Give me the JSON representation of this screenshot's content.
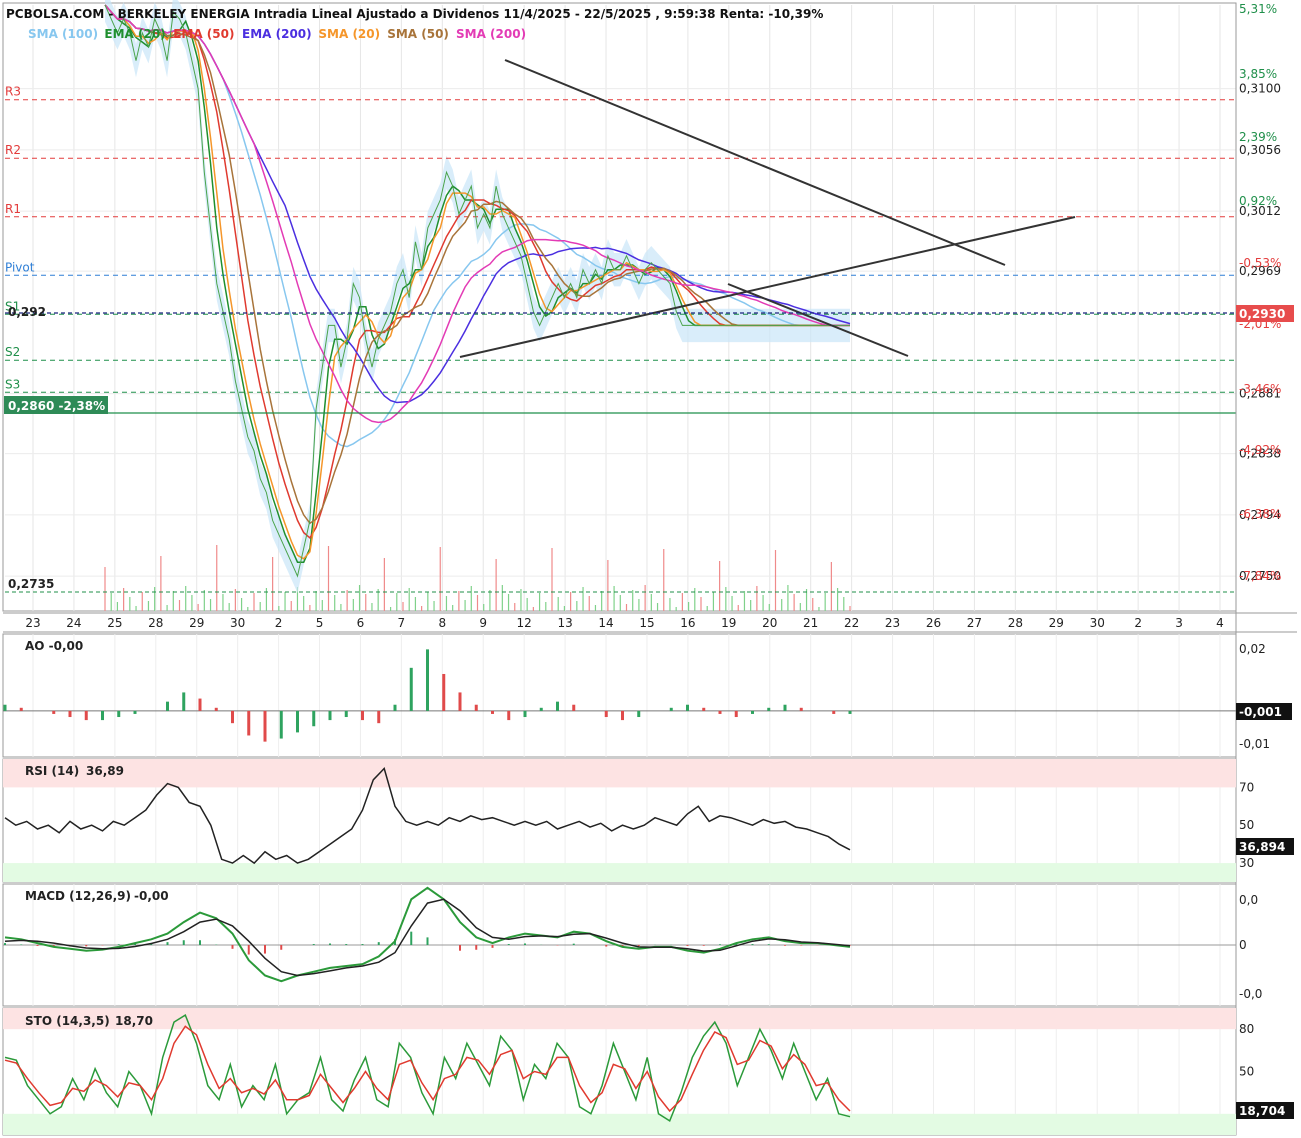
{
  "header": {
    "title": "PCBOLSA.COM - BERKELEY ENERGIA Intradia Lineal Ajustado a Dividenos 11/4/2025 - 22/5/2025 , 9:59:38 Renta: -10,39%"
  },
  "legend": [
    {
      "label": "SMA (100)",
      "color": "#87c7ef"
    },
    {
      "label": "EMA (20)",
      "color": "#1f8f2f"
    },
    {
      "label": "EMA (50)",
      "color": "#e03a2f"
    },
    {
      "label": "EMA (200)",
      "color": "#4b2fe0"
    },
    {
      "label": "SMA (20)",
      "color": "#f5962a"
    },
    {
      "label": "SMA (50)",
      "color": "#a8743a"
    },
    {
      "label": "SMA (200)",
      "color": "#e33bb5"
    }
  ],
  "pivots": [
    {
      "label": "R3",
      "value": 0.3092,
      "color": "#e33b3b"
    },
    {
      "label": "R2",
      "value": 0.305,
      "color": "#e33b3b"
    },
    {
      "label": "R1",
      "value": 0.3008,
      "color": "#e33b3b"
    },
    {
      "label": "Pivot",
      "value": 0.2966,
      "color": "#2f7fd6"
    },
    {
      "label": "S1",
      "value": 0.2938,
      "color": "#1f8f4a"
    },
    {
      "label": "S2",
      "value": 0.2905,
      "color": "#1f8f4a"
    },
    {
      "label": "S3",
      "value": 0.2882,
      "color": "#1f8f4a"
    }
  ],
  "markers": {
    "last_price": "0,2930",
    "level_292": "0,292",
    "support_tag": "0,2860 -2,38%",
    "low_label": "0,2735"
  },
  "chart_data": [
    {
      "type": "line",
      "title": "PCBOLSA.COM - BERKELEY ENERGIA Intradia Lineal Ajustado a Dividenos 11/4/2025 - 22/5/2025 , 9:59:38 Renta: -10,39%",
      "x_tick_labels": [
        "23",
        "24",
        "25",
        "28",
        "29",
        "30",
        "2",
        "5",
        "6",
        "7",
        "8",
        "9",
        "12",
        "13",
        "14",
        "15",
        "16",
        "19",
        "20",
        "21",
        "22",
        "23",
        "26",
        "27",
        "28",
        "29",
        "30",
        "2",
        "3",
        "4"
      ],
      "y_tick_labels": [
        "0,3100",
        "0,3056",
        "0,3012",
        "0,2969",
        "0,2930",
        "0,2881",
        "0,2838",
        "0,2794",
        "0,2750"
      ],
      "y_pct_labels": [
        "5,31%",
        "3,85%",
        "2,39%",
        "0,92%",
        "-0,53%",
        "-2,01%",
        "-3,46%",
        "-4,92%",
        "-6,38%",
        "-7,84%"
      ],
      "ylim": [
        0.2725,
        0.316
      ],
      "last": 0.293,
      "series": [
        {
          "name": "Precio",
          "x": [
            0,
            1,
            2,
            3,
            4,
            5,
            6,
            7,
            8,
            9,
            10,
            11,
            12,
            13,
            14,
            15,
            16,
            17,
            18,
            19,
            20,
            21,
            22,
            23,
            24,
            25,
            26,
            27,
            28,
            29,
            30,
            31,
            32,
            33,
            34,
            35,
            36,
            37,
            38,
            39,
            40,
            41,
            42,
            43,
            44,
            45,
            46,
            47,
            48,
            49,
            50,
            51,
            52,
            53,
            54,
            55,
            56,
            57,
            58,
            59,
            60,
            61,
            62,
            63,
            64,
            65,
            66,
            67,
            68,
            69,
            70,
            71,
            72,
            73,
            74,
            75,
            76,
            77,
            78,
            79,
            80,
            81,
            82,
            83,
            84,
            85,
            86,
            87,
            88,
            89,
            90,
            91,
            92,
            93,
            94,
            95,
            96,
            97,
            98,
            99,
            100,
            101,
            102,
            103,
            104,
            105,
            106,
            107,
            108,
            109,
            110,
            111,
            112,
            113,
            114,
            115,
            116,
            117,
            118,
            119,
            120
          ],
          "values": [
            0.316,
            0.315,
            0.314,
            0.315,
            0.314,
            0.312,
            0.314,
            0.313,
            0.315,
            0.314,
            0.312,
            0.3155,
            0.315,
            0.314,
            0.312,
            0.31,
            0.304,
            0.3,
            0.296,
            0.294,
            0.292,
            0.289,
            0.287,
            0.285,
            0.284,
            0.282,
            0.281,
            0.279,
            0.278,
            0.277,
            0.276,
            0.275,
            0.277,
            0.279,
            0.287,
            0.29,
            0.293,
            0.293,
            0.29,
            0.292,
            0.296,
            0.295,
            0.292,
            0.29,
            0.292,
            0.293,
            0.294,
            0.296,
            0.297,
            0.295,
            0.299,
            0.297,
            0.3,
            0.301,
            0.302,
            0.304,
            0.303,
            0.301,
            0.302,
            0.303,
            0.3,
            0.301,
            0.3,
            0.303,
            0.301,
            0.3,
            0.299,
            0.298,
            0.296,
            0.294,
            0.293,
            0.294,
            0.295,
            0.296,
            0.295,
            0.296,
            0.295,
            0.297,
            0.296,
            0.297,
            0.296,
            0.298,
            0.297,
            0.297,
            0.298,
            0.297,
            0.296,
            0.297,
            0.2975,
            0.297,
            0.2965,
            0.296,
            0.294,
            0.293,
            0.293,
            0.293,
            0.293,
            0.293,
            0.293,
            0.293,
            0.293,
            0.293,
            0.293,
            0.293,
            0.293,
            0.293,
            0.293,
            0.293,
            0.293,
            0.293,
            0.293,
            0.293,
            0.293,
            0.293,
            0.293,
            0.293,
            0.293,
            0.293,
            0.293,
            0.293,
            0.293
          ],
          "color": "#1f8f2f"
        }
      ]
    },
    {
      "type": "line",
      "title": "AO -0,00",
      "y_tick_labels": [
        "0,02",
        "-0,01"
      ],
      "last": "-0,001",
      "ylim": [
        -0.015,
        0.025
      ],
      "values": [
        0.002,
        0.001,
        0.0,
        -0.001,
        -0.002,
        -0.003,
        -0.003,
        -0.002,
        -0.001,
        0.0,
        0.003,
        0.006,
        0.004,
        0.001,
        -0.004,
        -0.008,
        -0.01,
        -0.009,
        -0.007,
        -0.005,
        -0.003,
        -0.002,
        -0.003,
        -0.004,
        0.002,
        0.014,
        0.02,
        0.012,
        0.006,
        0.002,
        -0.001,
        -0.003,
        -0.002,
        0.001,
        0.003,
        0.002,
        0.0,
        -0.002,
        -0.003,
        -0.002,
        0.0,
        0.001,
        0.002,
        0.001,
        -0.001,
        -0.002,
        -0.001,
        0.001,
        0.002,
        0.001,
        0.0,
        -0.001,
        -0.001
      ]
    },
    {
      "type": "line",
      "title": "RSI (14)",
      "value_label": "36,89",
      "y_tick_labels": [
        "70",
        "50",
        "30"
      ],
      "last": "36,894",
      "ylim": [
        20,
        85
      ],
      "values": [
        54,
        50,
        52,
        48,
        50,
        46,
        52,
        48,
        50,
        47,
        52,
        50,
        54,
        58,
        66,
        72,
        70,
        62,
        60,
        50,
        32,
        30,
        34,
        30,
        36,
        32,
        34,
        30,
        32,
        36,
        40,
        44,
        48,
        58,
        74,
        80,
        60,
        52,
        50,
        52,
        50,
        54,
        52,
        55,
        53,
        54,
        52,
        50,
        52,
        50,
        52,
        48,
        50,
        52,
        49,
        51,
        47,
        50,
        48,
        50,
        54,
        52,
        50,
        56,
        60,
        52,
        55,
        54,
        52,
        50,
        53,
        51,
        52,
        49,
        48,
        46,
        44,
        40,
        37
      ]
    },
    {
      "type": "line",
      "title": "MACD (12,26,9)",
      "value_label": "-0,00",
      "y_tick_labels": [
        "0,0",
        "0",
        "-0,0"
      ],
      "ylim": [
        -1.6,
        1.6
      ],
      "series": [
        {
          "name": "MACD",
          "values": [
            0.2,
            0.15,
            0.05,
            -0.05,
            -0.1,
            -0.15,
            -0.12,
            -0.05,
            0.05,
            0.15,
            0.3,
            0.6,
            0.85,
            0.7,
            0.3,
            -0.4,
            -0.8,
            -0.95,
            -0.8,
            -0.7,
            -0.6,
            -0.55,
            -0.5,
            -0.3,
            0.1,
            1.2,
            1.5,
            1.2,
            0.6,
            0.2,
            0.05,
            0.2,
            0.3,
            0.25,
            0.2,
            0.35,
            0.3,
            0.1,
            -0.05,
            -0.1,
            -0.05,
            -0.05,
            -0.15,
            -0.2,
            -0.1,
            0.05,
            0.15,
            0.2,
            0.1,
            0.05,
            0.05,
            0.0,
            -0.05
          ]
        },
        {
          "name": "Signal",
          "values": [
            0.1,
            0.12,
            0.1,
            0.05,
            -0.02,
            -0.08,
            -0.1,
            -0.09,
            -0.04,
            0.04,
            0.15,
            0.35,
            0.6,
            0.68,
            0.5,
            0.1,
            -0.35,
            -0.7,
            -0.8,
            -0.75,
            -0.68,
            -0.6,
            -0.55,
            -0.45,
            -0.2,
            0.5,
            1.1,
            1.2,
            0.9,
            0.45,
            0.2,
            0.15,
            0.22,
            0.24,
            0.22,
            0.28,
            0.3,
            0.18,
            0.05,
            -0.05,
            -0.06,
            -0.06,
            -0.1,
            -0.16,
            -0.14,
            -0.02,
            0.1,
            0.16,
            0.14,
            0.08,
            0.06,
            0.02,
            -0.02
          ]
        }
      ]
    },
    {
      "type": "line",
      "title": "STO (14,3,5)",
      "value_label": "18,70",
      "y_tick_labels": [
        "80",
        "50",
        "20"
      ],
      "last": "18,704",
      "ylim": [
        5,
        95
      ],
      "series": [
        {
          "name": "%K",
          "values": [
            60,
            58,
            40,
            30,
            20,
            25,
            45,
            30,
            52,
            35,
            25,
            50,
            40,
            20,
            60,
            85,
            90,
            70,
            40,
            30,
            55,
            25,
            40,
            30,
            55,
            20,
            30,
            35,
            60,
            30,
            22,
            44,
            60,
            30,
            25,
            70,
            60,
            35,
            20,
            60,
            45,
            70,
            55,
            40,
            75,
            65,
            30,
            55,
            45,
            70,
            60,
            25,
            20,
            40,
            70,
            50,
            30,
            60,
            20,
            15,
            35,
            60,
            75,
            85,
            70,
            40,
            60,
            80,
            65,
            45,
            70,
            50,
            30,
            45,
            20,
            18
          ]
        },
        {
          "name": "%D",
          "values": [
            58,
            56,
            45,
            35,
            26,
            28,
            38,
            36,
            44,
            40,
            32,
            42,
            40,
            30,
            45,
            70,
            82,
            76,
            55,
            38,
            45,
            35,
            38,
            34,
            44,
            30,
            30,
            33,
            48,
            38,
            28,
            38,
            50,
            38,
            30,
            55,
            58,
            42,
            30,
            45,
            48,
            60,
            58,
            48,
            62,
            65,
            45,
            50,
            48,
            60,
            60,
            40,
            28,
            35,
            55,
            52,
            38,
            50,
            32,
            22,
            30,
            48,
            65,
            78,
            74,
            55,
            58,
            72,
            68,
            52,
            62,
            55,
            40,
            42,
            30,
            22
          ]
        }
      ]
    }
  ]
}
